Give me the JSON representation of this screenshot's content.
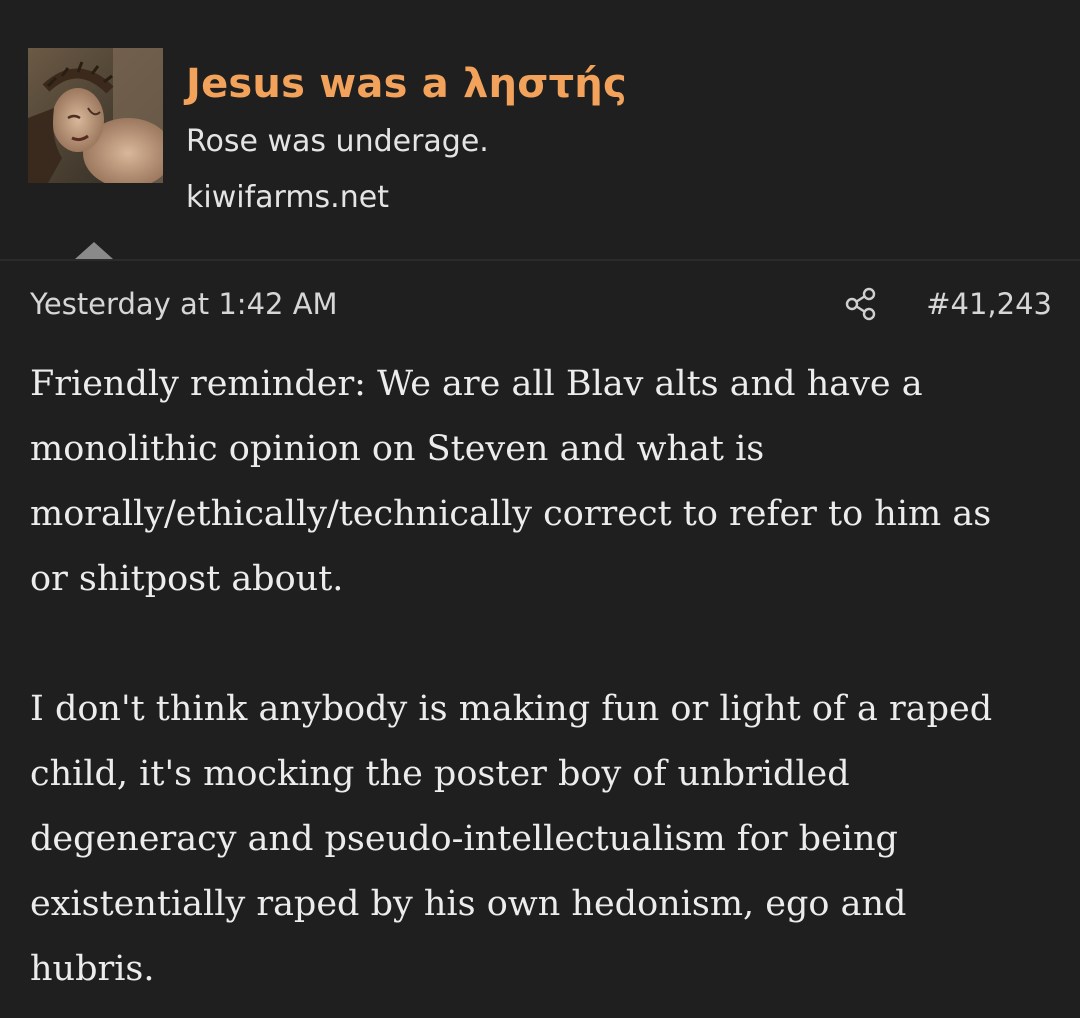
{
  "post": {
    "author": {
      "username": "Jesus was a ληστής",
      "user_title": "Rose was underage.",
      "site": "kiwifarms.net",
      "avatar_icon": "crucified-figure-avatar"
    },
    "meta": {
      "timestamp": "Yesterday at 1:42 AM",
      "share_icon": "share-icon",
      "post_number": "#41,243"
    },
    "body": {
      "paragraphs": [
        "Friendly reminder: We are all Blav alts and have a monolithic opinion on Steven and what is morally/ethically/technically correct to refer to him as or shitpost about.",
        "I don't think anybody is making fun or light of a raped child, it's mocking the poster boy of unbridled degeneracy and pseudo-intellectualism for being existentially raped by his own hedonism, ego and hubris."
      ]
    },
    "colors": {
      "background": "#1f1f1f",
      "username": "#f2a25a",
      "text": "#ececec",
      "muted": "#8a8a8a"
    }
  }
}
